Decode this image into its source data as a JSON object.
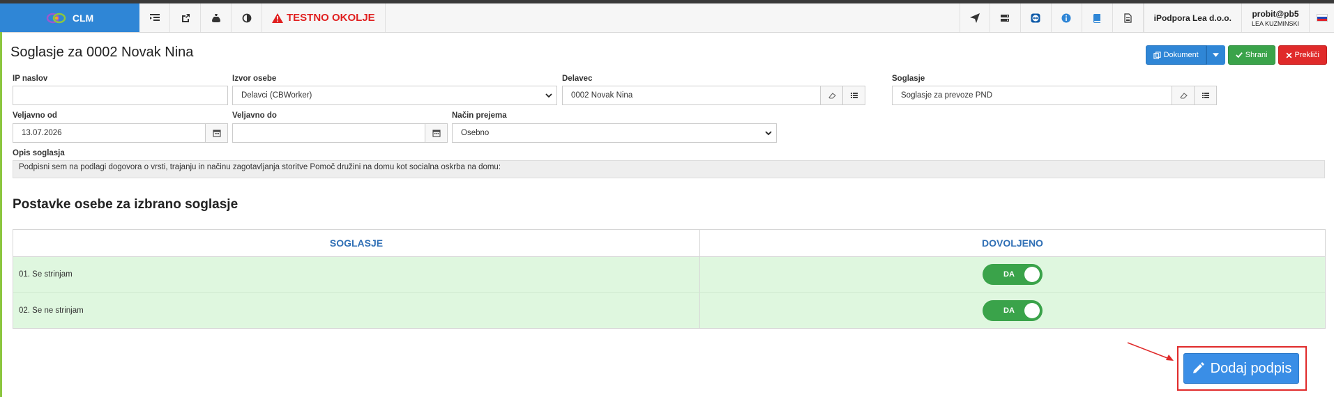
{
  "navbar": {
    "brand": "CLM",
    "warning": "TESTNO OKOLJE",
    "company": "iPodpora Lea d.o.o.",
    "user_login": "probit@pb5",
    "user_name": "LEA KUZMINSKI"
  },
  "page": {
    "title": "Soglasje za 0002 Novak Nina"
  },
  "actions": {
    "document": "Dokument",
    "save": "Shrani",
    "cancel": "Prekliči"
  },
  "form": {
    "ip_label": "IP naslov",
    "ip_value": "",
    "source_label": "Izvor osebe",
    "source_value": "Delavci (CBWorker)",
    "worker_label": "Delavec",
    "worker_value": "0002 Novak Nina",
    "consent_label": "Soglasje",
    "consent_value": "Soglasje za prevoze PND",
    "valid_from_label": "Veljavno od",
    "valid_from_value": "13.07.2026",
    "valid_to_label": "Veljavno do",
    "valid_to_value": "",
    "method_label": "Način prejema",
    "method_value": "Osebno",
    "desc_label": "Opis soglasja",
    "desc_value": "Podpisni sem na podlagi dogovora o vrsti, trajanju in načinu zagotavljanja storitve Pomoč družini na domu kot socialna oskrba na domu:"
  },
  "items": {
    "title": "Postavke osebe za izbrano soglasje",
    "col_consent": "SOGLASJE",
    "col_allowed": "DOVOLJENO",
    "rows": [
      {
        "label": "01. Se strinjam",
        "toggle": "DA"
      },
      {
        "label": "02. Se ne strinjam",
        "toggle": "DA"
      }
    ]
  },
  "signature": {
    "label": "Dodaj podpis"
  }
}
